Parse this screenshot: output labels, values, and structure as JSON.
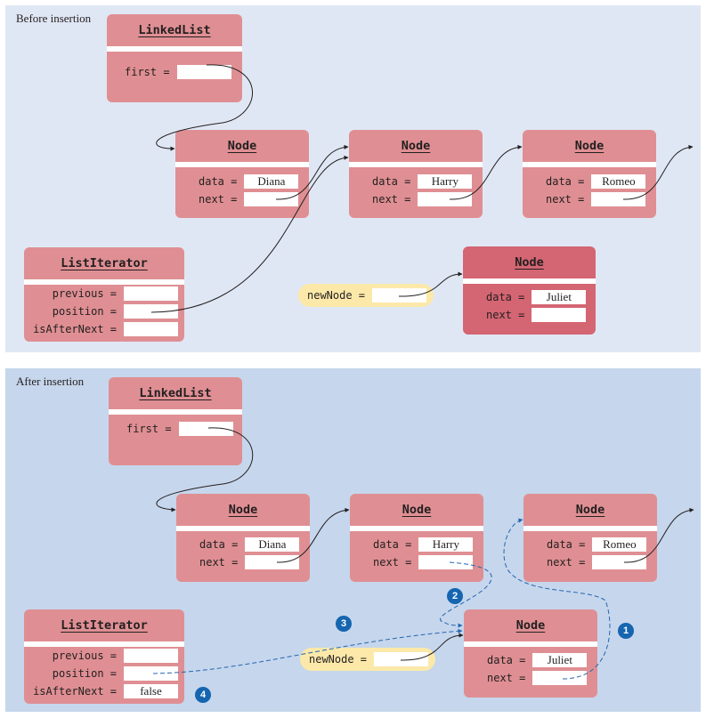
{
  "before": {
    "label": "Before insertion",
    "linked_list": {
      "title": "LinkedList",
      "first_label": "first ="
    },
    "nodes": [
      {
        "title": "Node",
        "data_label": "data =",
        "next_label": "next =",
        "data": "Diana"
      },
      {
        "title": "Node",
        "data_label": "data =",
        "next_label": "next =",
        "data": "Harry"
      },
      {
        "title": "Node",
        "data_label": "data =",
        "next_label": "next =",
        "data": "Romeo"
      }
    ],
    "iterator": {
      "title": "ListIterator",
      "previous_label": "previous =",
      "position_label": "position =",
      "is_after_next_label": "isAfterNext =",
      "is_after_next": ""
    },
    "new_node_var": {
      "label": "newNode ="
    },
    "new_node": {
      "title": "Node",
      "data_label": "data =",
      "next_label": "next =",
      "data": "Juliet"
    }
  },
  "after": {
    "label": "After insertion",
    "linked_list": {
      "title": "LinkedList",
      "first_label": "first ="
    },
    "nodes": [
      {
        "title": "Node",
        "data_label": "data =",
        "next_label": "next =",
        "data": "Diana"
      },
      {
        "title": "Node",
        "data_label": "data =",
        "next_label": "next =",
        "data": "Harry"
      },
      {
        "title": "Node",
        "data_label": "data =",
        "next_label": "next =",
        "data": "Romeo"
      }
    ],
    "iterator": {
      "title": "ListIterator",
      "previous_label": "previous =",
      "position_label": "position =",
      "is_after_next_label": "isAfterNext =",
      "is_after_next": "false"
    },
    "new_node_var": {
      "label": "newNode ="
    },
    "new_node": {
      "title": "Node",
      "data_label": "data =",
      "next_label": "next =",
      "data": "Juliet"
    },
    "step_badges": [
      "1",
      "2",
      "3",
      "4"
    ]
  },
  "colors": {
    "box": "#df8f93",
    "new_node_before": "#d46572",
    "variable_pill": "#fce9a9",
    "panel_before": "#e0e7f4",
    "panel_after": "#c6d6ec",
    "badge": "#1565b0",
    "changed_link": "#2566b0"
  }
}
